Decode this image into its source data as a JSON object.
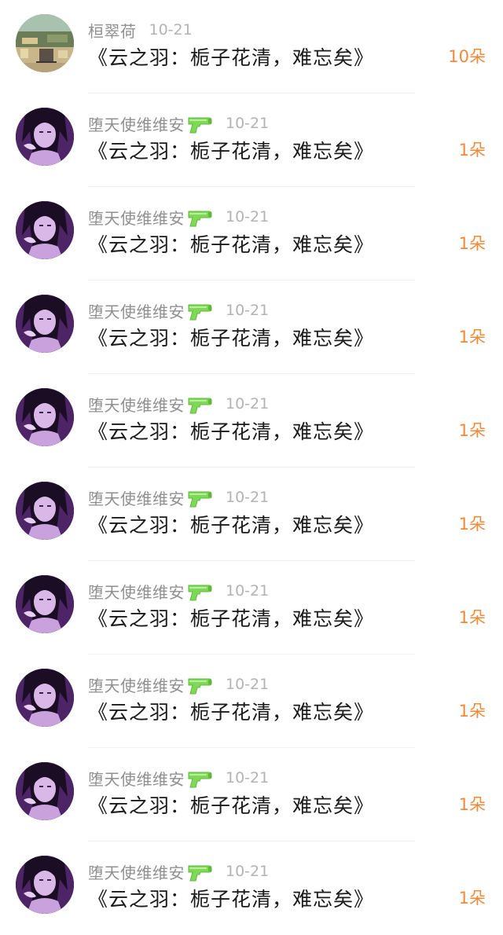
{
  "rows": [
    {
      "username": "桓翠荷",
      "has_badge": false,
      "date": "10-21",
      "title": "《云之羽：栀子花清，难忘矣》",
      "count": "10朵",
      "avatar": "landscape-avatar"
    },
    {
      "username": "堕天使维维安",
      "has_badge": true,
      "date": "10-21",
      "title": "《云之羽：栀子花清，难忘矣》",
      "count": "1朵",
      "avatar": "purple-girl-avatar"
    },
    {
      "username": "堕天使维维安",
      "has_badge": true,
      "date": "10-21",
      "title": "《云之羽：栀子花清，难忘矣》",
      "count": "1朵",
      "avatar": "purple-girl-avatar"
    },
    {
      "username": "堕天使维维安",
      "has_badge": true,
      "date": "10-21",
      "title": "《云之羽：栀子花清，难忘矣》",
      "count": "1朵",
      "avatar": "purple-girl-avatar"
    },
    {
      "username": "堕天使维维安",
      "has_badge": true,
      "date": "10-21",
      "title": "《云之羽：栀子花清，难忘矣》",
      "count": "1朵",
      "avatar": "purple-girl-avatar"
    },
    {
      "username": "堕天使维维安",
      "has_badge": true,
      "date": "10-21",
      "title": "《云之羽：栀子花清，难忘矣》",
      "count": "1朵",
      "avatar": "purple-girl-avatar"
    },
    {
      "username": "堕天使维维安",
      "has_badge": true,
      "date": "10-21",
      "title": "《云之羽：栀子花清，难忘矣》",
      "count": "1朵",
      "avatar": "purple-girl-avatar"
    },
    {
      "username": "堕天使维维安",
      "has_badge": true,
      "date": "10-21",
      "title": "《云之羽：栀子花清，难忘矣》",
      "count": "1朵",
      "avatar": "purple-girl-avatar"
    },
    {
      "username": "堕天使维维安",
      "has_badge": true,
      "date": "10-21",
      "title": "《云之羽：栀子花清，难忘矣》",
      "count": "1朵",
      "avatar": "purple-girl-avatar"
    },
    {
      "username": "堕天使维维安",
      "has_badge": true,
      "date": "10-21",
      "title": "《云之羽：栀子花清，难忘矣》",
      "count": "1朵",
      "avatar": "purple-girl-avatar"
    }
  ],
  "badge_icon": "water-gun-icon",
  "colors": {
    "count": "#f08a3a",
    "username": "#8f8f8f",
    "date": "#b3b3b3",
    "title": "#1a1a1a",
    "badge": "#7ed957"
  }
}
